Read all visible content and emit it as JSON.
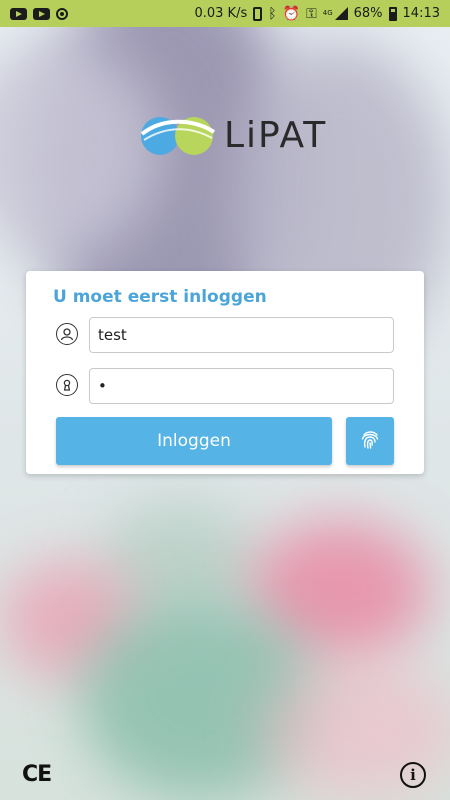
{
  "status_bar": {
    "network_speed": "0.03 K/s",
    "network_type": "4G",
    "battery_percent": "68%",
    "time": "14:13",
    "bg_color": "#b6cf5b"
  },
  "logo": {
    "text": "LiPAT",
    "colors": {
      "blue": "#4ca9e2",
      "green": "#b8d55c"
    }
  },
  "login": {
    "title": "U moet eerst inloggen",
    "username_value": "test",
    "password_value": "•",
    "login_label": "Inloggen",
    "accent_color": "#55b3e5"
  },
  "footer": {
    "ce_label": "CE",
    "info_label": "i"
  },
  "icons": [
    "youtube-icon",
    "youtube-icon",
    "circle-app-icon",
    "phone-icon",
    "bluetooth-icon",
    "alarm-icon",
    "key-icon",
    "signal-icon",
    "battery-icon",
    "user-icon",
    "keyhole-icon",
    "fingerprint-icon",
    "info-icon"
  ]
}
